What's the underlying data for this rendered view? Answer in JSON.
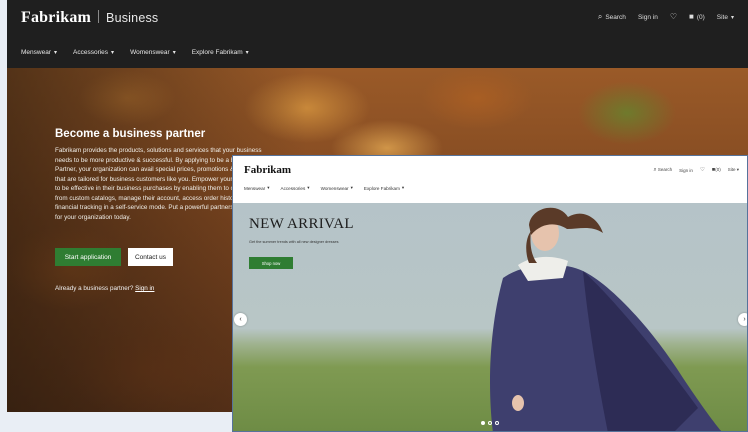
{
  "back": {
    "brand": "Fabrikam",
    "brand_sub": "Business",
    "utils": {
      "search": "Search",
      "sign_in": "Sign in",
      "cart_count": "(0)",
      "site": "Site"
    },
    "nav": [
      "Menswear",
      "Accessories",
      "Womenswear",
      "Explore Fabrikam"
    ],
    "hero": {
      "title": "Become a business partner",
      "body": "Fabrikam provides the products, solutions and services that your business needs to be more productive & successful. By applying to be a Business Partner, your organization can avail special prices, promotions & bundles that are tailored for business customers like you. Empower your employees to be effective in their business purchases by enabling them to order online from custom catalogs, manage their account, access order history & financial tracking in a self-service mode. Put a powerful partnership to work for your organization today.",
      "primary_button": "Start application",
      "secondary_button": "Contact us",
      "note": "Already a business partner?",
      "note_link": "Sign in"
    }
  },
  "front": {
    "brand": "Fabrikam",
    "utils": {
      "search": "Search",
      "sign_in": "Sign in",
      "cart_count": "(0)",
      "site": "Site"
    },
    "nav": [
      "Menswear",
      "Accessories",
      "Womenswear",
      "Explore Fabrikam"
    ],
    "hero": {
      "title": "NEW ARRIVAL",
      "subtitle": "Get the summer trends with all new designer dresses",
      "button": "Shop now",
      "slides": 3,
      "active_slide": 1
    }
  },
  "colors": {
    "header_dark": "#1f1f1f",
    "accent_green": "#2f7d32",
    "frame_border": "#56739b"
  },
  "icons": [
    "search-icon",
    "heart-icon",
    "bag-icon",
    "chevron-down-icon",
    "chevron-left-icon",
    "chevron-right-icon"
  ]
}
